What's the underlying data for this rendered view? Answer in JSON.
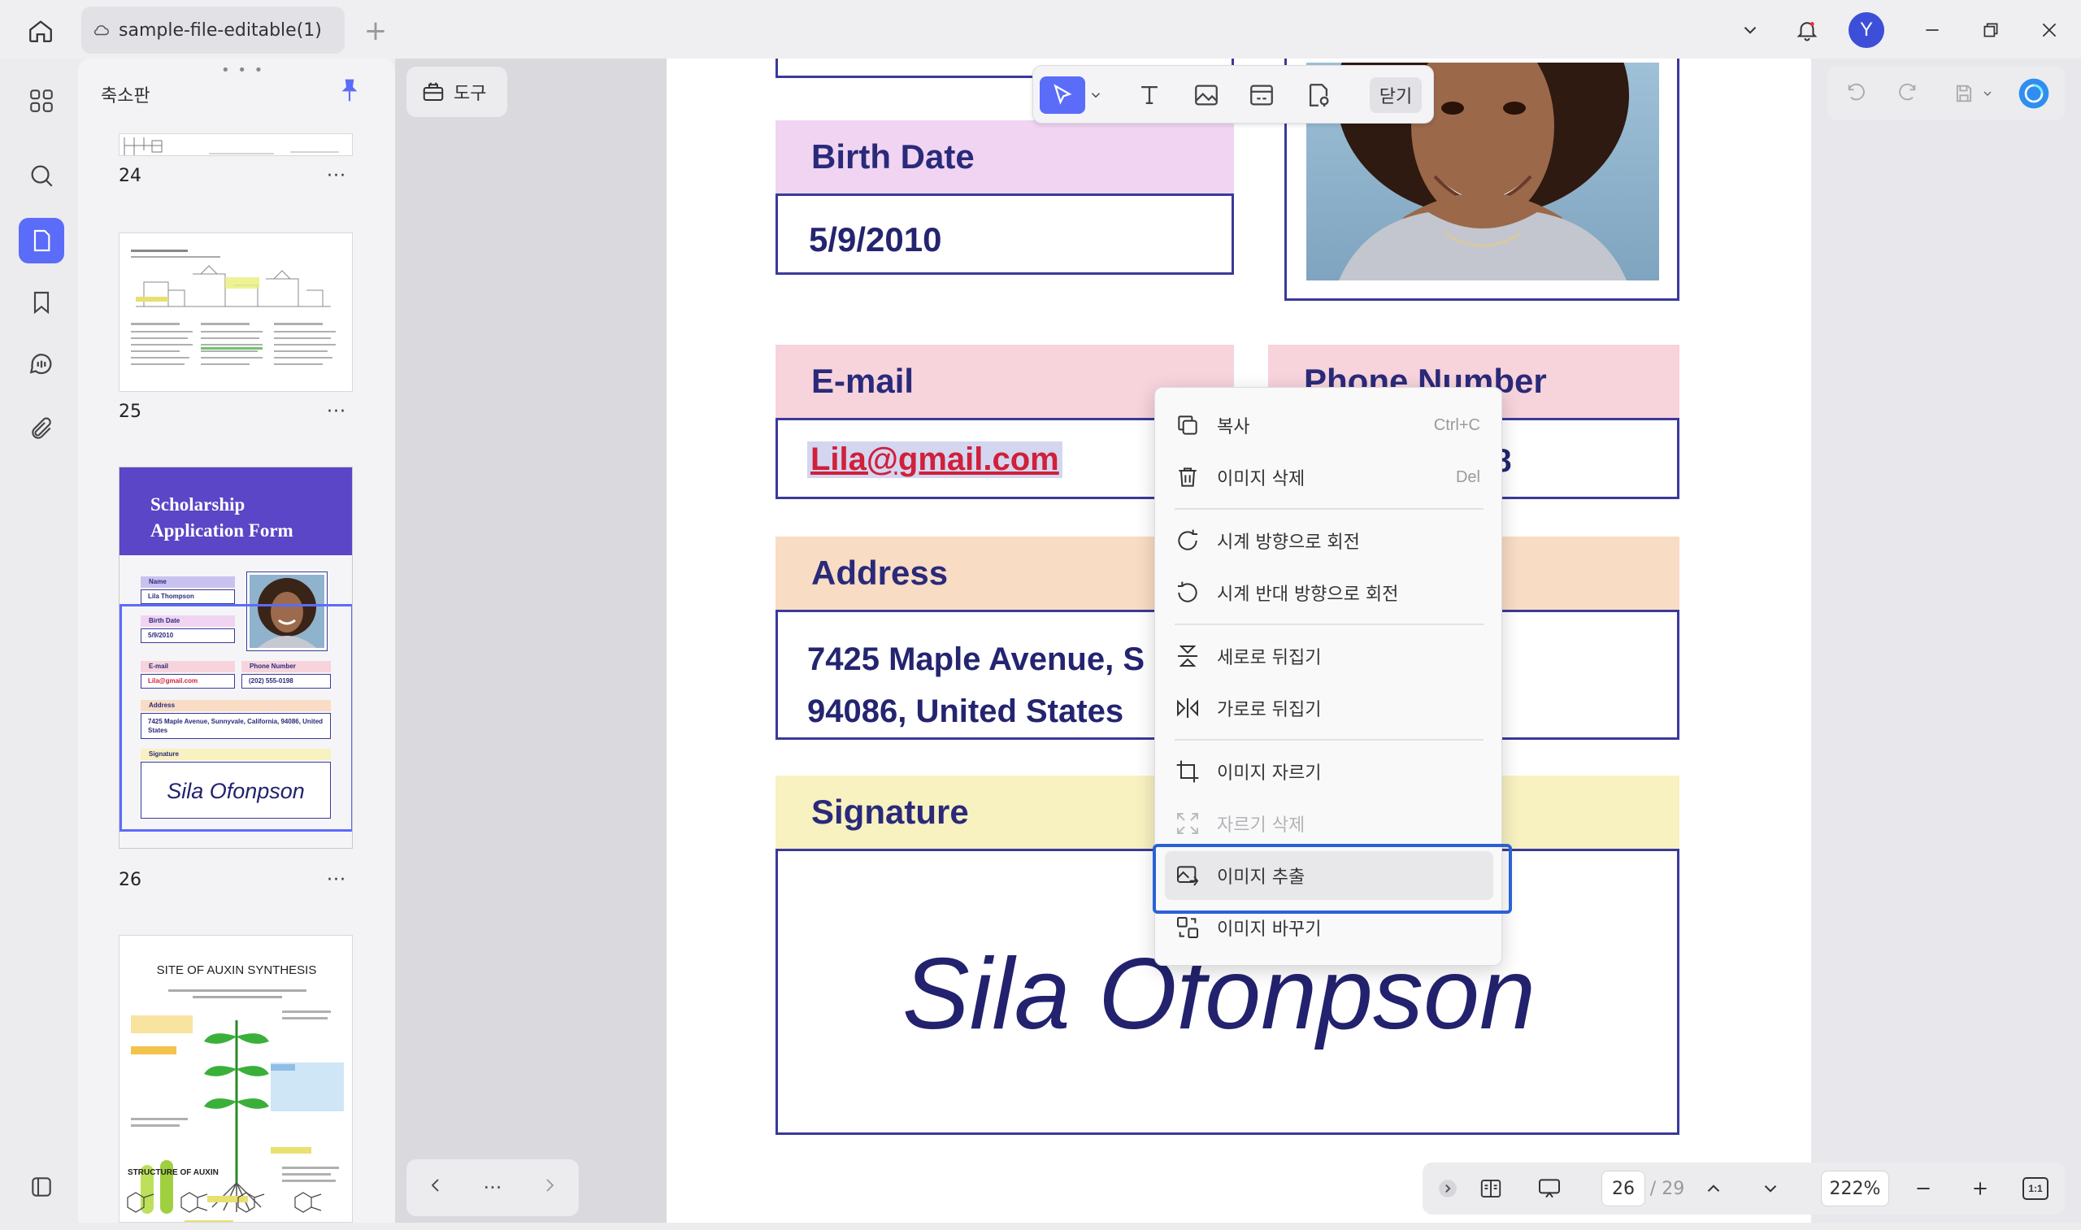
{
  "window": {
    "tab_title": "sample-file-editable(1)",
    "avatar_letter": "Y"
  },
  "thumb_panel": {
    "title": "축소판",
    "pages": [
      {
        "num": "24"
      },
      {
        "num": "25"
      },
      {
        "num": "26"
      },
      {
        "num": ""
      }
    ],
    "more": "···",
    "thumb26": {
      "title": "Scholarship Application Form",
      "name_label": "Name",
      "name_value": "Lila Thompson",
      "birth_label": "Birth Date",
      "birth_value": "5/9/2010",
      "email_label": "E-mail",
      "email_value": "Lila@gmail.com",
      "phone_label": "Phone Number",
      "phone_value": "(202) 555-0198",
      "address_label": "Address",
      "address_value": "7425 Maple Avenue, Sunnyvale, California, 94086, United States",
      "signature_label": "Signature",
      "signature_value": "Sila Ofonpson"
    },
    "thumb27": {
      "title": "SITE OF AUXIN SYNTHESIS",
      "footer": "STRUCTURE OF AUXIN"
    }
  },
  "tools_button": "도구",
  "pager": {
    "more": "···"
  },
  "floating_toolbar": {
    "close": "닫기"
  },
  "document": {
    "birth_label": "Birth Date",
    "birth_value": "5/9/2010",
    "email_label": "E-mail",
    "email_value": "Lila@gmail.com",
    "phone_label": "Phone Number",
    "phone_value_partial": "98",
    "address_label": "Address",
    "address_line1": "7425 Maple Avenue, S",
    "address_line2": "94086, United States",
    "signature_label": "Signature",
    "signature_value": "Sila Ofonpson"
  },
  "context_menu": {
    "items": [
      {
        "label": "복사",
        "shortcut": "Ctrl+C",
        "icon": "copy-icon"
      },
      {
        "label": "이미지 삭제",
        "shortcut": "Del",
        "icon": "trash-icon"
      },
      {
        "label": "시계 방향으로 회전",
        "shortcut": "",
        "icon": "rotate-cw-icon"
      },
      {
        "label": "시계 반대 방향으로 회전",
        "shortcut": "",
        "icon": "rotate-ccw-icon"
      },
      {
        "label": "세로로 뒤집기",
        "shortcut": "",
        "icon": "flip-vertical-icon"
      },
      {
        "label": "가로로 뒤집기",
        "shortcut": "",
        "icon": "flip-horizontal-icon"
      },
      {
        "label": "이미지 자르기",
        "shortcut": "",
        "icon": "crop-icon"
      },
      {
        "label": "자르기 삭제",
        "shortcut": "",
        "icon": "remove-crop-icon"
      },
      {
        "label": "이미지 추출",
        "shortcut": "",
        "icon": "extract-image-icon"
      },
      {
        "label": "이미지 바꾸기",
        "shortcut": "",
        "icon": "replace-image-icon"
      }
    ]
  },
  "status_bar": {
    "current_page": "26",
    "total_pages": "/ 29",
    "zoom": "222%",
    "fit_label": "1:1"
  },
  "colors": {
    "accent": "#5b6cf9",
    "highlight_border": "#2a62d6",
    "form_navy": "#2a2a7a",
    "label_purple": "#f0d4f2",
    "label_pink": "#f7d3dc",
    "label_peach": "#f9dcc4",
    "label_yellow": "#f8f1c0",
    "email_red": "#d0203a"
  }
}
